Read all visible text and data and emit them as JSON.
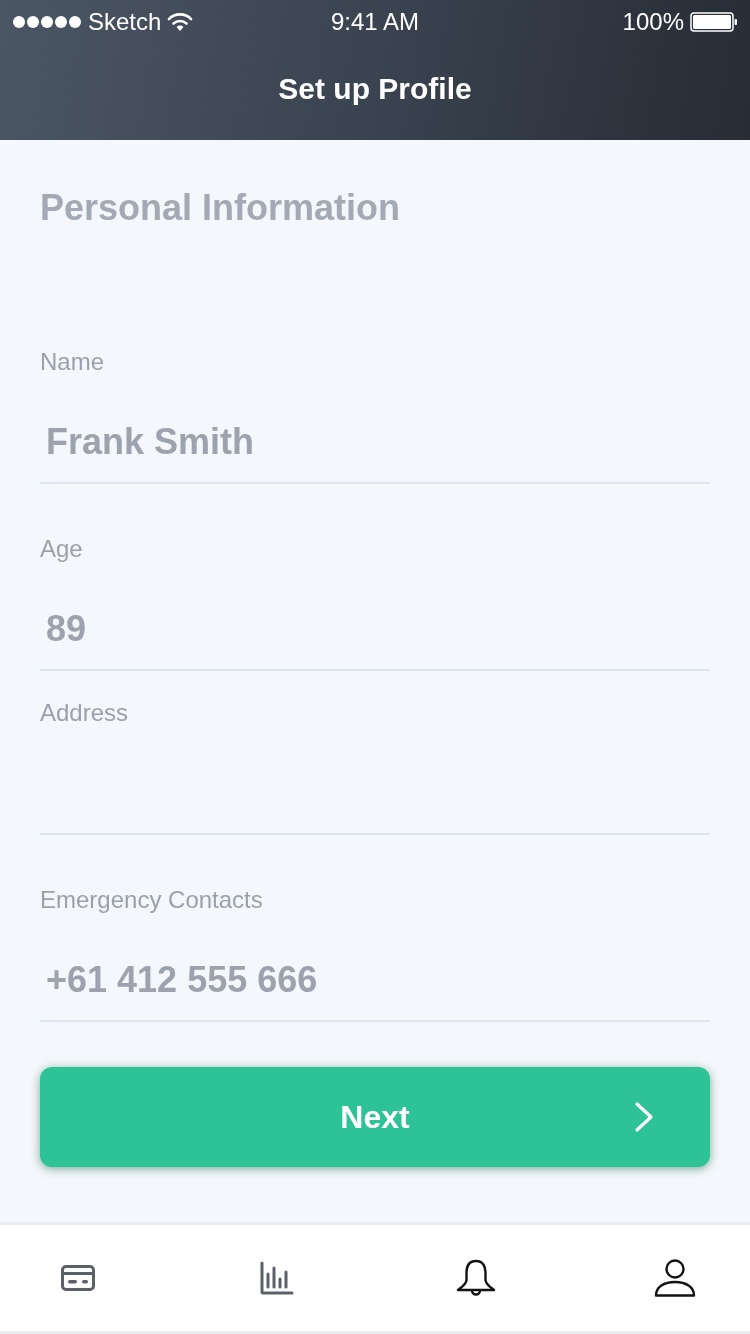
{
  "status_bar": {
    "carrier": "Sketch",
    "time": "9:41 AM",
    "battery": "100%"
  },
  "header": {
    "title": "Set up Profile"
  },
  "section": {
    "title": "Personal Information"
  },
  "fields": [
    {
      "label": "Name",
      "value": "Frank Smith"
    },
    {
      "label": "Age",
      "value": "89"
    },
    {
      "label": "Address"
    },
    {
      "label": "Emergency Contacts",
      "value": "+61 412 555 666"
    }
  ],
  "next_button": {
    "label": "Next"
  },
  "tab_bar": {
    "items": [
      {
        "kind": "card"
      },
      {
        "kind": "chart"
      },
      {
        "kind": "bell"
      },
      {
        "kind": "person"
      }
    ]
  }
}
